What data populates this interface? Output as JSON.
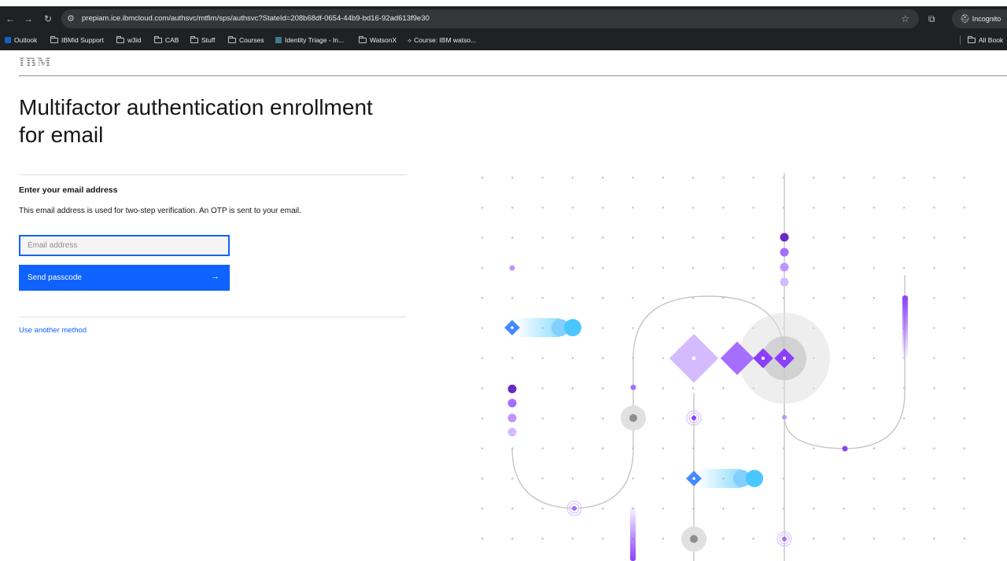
{
  "browser": {
    "url": "prepiam.ice.ibmcloud.com/authsvc/mtfim/sps/authsvc?StateId=208b68df-0654-44b9-bd16-92ad613f9e30",
    "incognito_label": "Incognito",
    "bookmarks": [
      "Outlook",
      "IBMid Support",
      "w3id",
      "CAB",
      "Stuff",
      "Courses",
      "Identity Triage - In...",
      "WatsonX",
      "Course: IBM watso...",
      "All Book"
    ]
  },
  "header": {
    "logo": "IBM"
  },
  "main": {
    "title_line1": "Multifactor authentication enrollment",
    "title_line2": "for email",
    "section_label": "Enter your email address",
    "description": "This email address is used for two-step verification. An OTP is sent to your email.",
    "email_placeholder": "Email address",
    "send_button": "Send passcode",
    "send_arrow": "→",
    "alt_method_link": "Use another method"
  },
  "colors": {
    "primary": "#0f62fe",
    "purple_dark": "#6929c4",
    "purple": "#8a3ffc",
    "purple_light": "#be95ff",
    "blue_light": "#4ac7ff"
  }
}
